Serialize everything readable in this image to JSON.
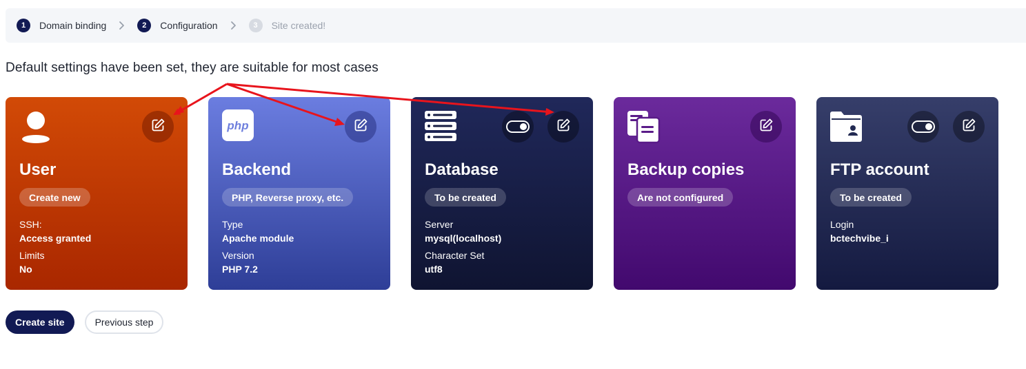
{
  "stepper": {
    "steps": [
      {
        "num": "1",
        "label": "Domain binding"
      },
      {
        "num": "2",
        "label": "Configuration"
      },
      {
        "num": "3",
        "label": "Site created!"
      }
    ]
  },
  "headline": "Default settings have been set, they are suitable for most cases",
  "cards": {
    "user": {
      "title": "User",
      "pill": "Create new",
      "fields": [
        {
          "label": "SSH:",
          "value": "Access granted"
        },
        {
          "label": "Limits",
          "value": "No"
        }
      ]
    },
    "backend": {
      "icon_text": "php",
      "title": "Backend",
      "pill": "PHP, Reverse proxy, etc.",
      "fields": [
        {
          "label": "Type",
          "value": "Apache module"
        },
        {
          "label": "Version",
          "value": "PHP 7.2"
        }
      ]
    },
    "database": {
      "title": "Database",
      "pill": "To be created",
      "toggle_on": true,
      "fields": [
        {
          "label": "Server",
          "value": "mysql(localhost)"
        },
        {
          "label": "Character Set",
          "value": "utf8"
        }
      ]
    },
    "backup": {
      "title": "Backup copies",
      "pill": "Are not configured"
    },
    "ftp": {
      "title": "FTP account",
      "pill": "To be created",
      "toggle_on": true,
      "fields": [
        {
          "label": "Login",
          "value": "bctechvibe_i"
        }
      ]
    }
  },
  "actions": {
    "create_label": "Create site",
    "previous_label": "Previous step"
  },
  "icons": {
    "user": "user-icon",
    "backend": "php-icon",
    "database": "server-stack-icon",
    "backup": "documents-icon",
    "ftp": "folder-user-icon",
    "edit": "edit-icon",
    "toggle": "toggle-icon",
    "step_separator": "chevron-right-icon"
  },
  "colors": {
    "primary": "#121a54",
    "user_card": "#c33c04",
    "backend_card": "#5566c8",
    "database_card": "#161c42",
    "backup_card": "#5a1b88",
    "ftp_card": "#222a52",
    "annotation_arrow": "#e8141c"
  }
}
